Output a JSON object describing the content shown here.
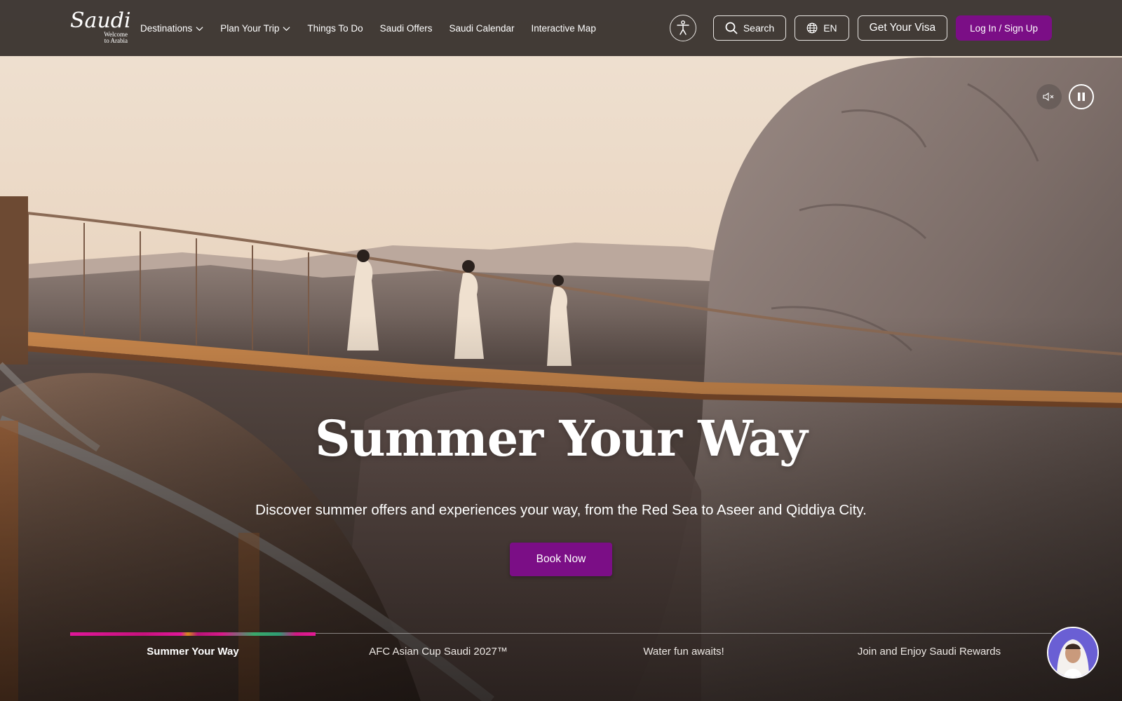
{
  "brand": {
    "logo_text": "Saudi",
    "logo_sub_line1": "Welcome",
    "logo_sub_line2": "to Arabia"
  },
  "nav": {
    "items": [
      {
        "label": "Destinations",
        "dropdown": true
      },
      {
        "label": "Plan Your Trip",
        "dropdown": true
      },
      {
        "label": "Things To Do",
        "dropdown": false
      },
      {
        "label": "Saudi Offers",
        "dropdown": false
      },
      {
        "label": "Saudi Calendar",
        "dropdown": false
      },
      {
        "label": "Interactive Map",
        "dropdown": false
      }
    ]
  },
  "header_actions": {
    "accessibility_icon": "accessibility-icon",
    "search_label": "Search",
    "language_label": "EN",
    "visa_label": "Get Your Visa",
    "login_label": "Log In / Sign Up"
  },
  "hero": {
    "title": "Summer Your Way",
    "subtitle": "Discover summer offers and experiences your way, from the Red Sea to Aseer and Qiddiya City.",
    "cta_label": "Book Now",
    "video_muted": true,
    "video_playing": true
  },
  "carousel": {
    "tabs": [
      {
        "label": "Summer Your Way",
        "active": true
      },
      {
        "label": "AFC Asian Cup Saudi 2027™",
        "active": false
      },
      {
        "label": "Water fun awaits!",
        "active": false
      },
      {
        "label": "Join and Enjoy Saudi Rewards",
        "active": false
      }
    ]
  },
  "colors": {
    "header_bg": "#3a3430",
    "primary": "#7b0e86",
    "text": "#ffffff"
  }
}
